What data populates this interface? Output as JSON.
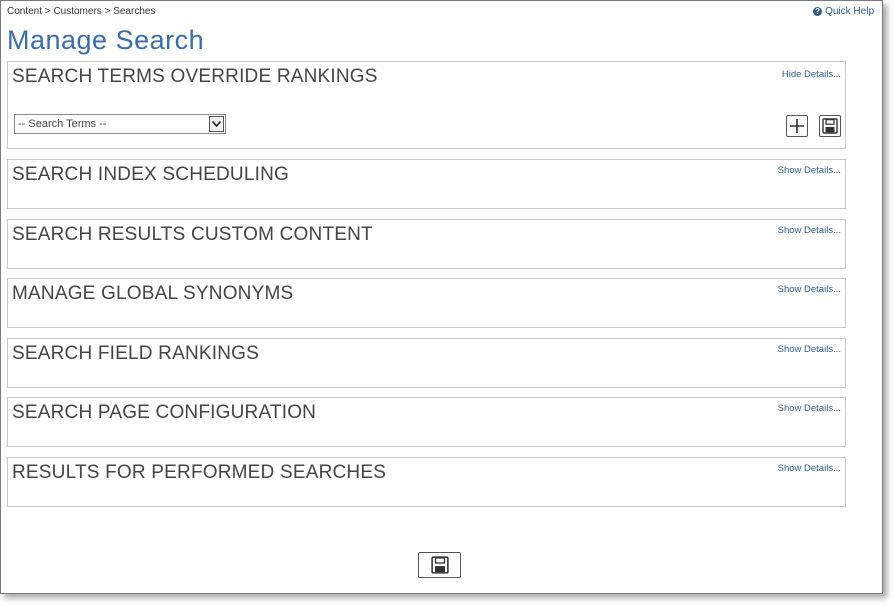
{
  "breadcrumb": {
    "items": [
      "Content",
      "Customers",
      "Searches"
    ],
    "separator": " > ",
    "text": "Content > Customers > Searches"
  },
  "quick_help": {
    "label": "Quick Help",
    "icon": "question-circle-icon"
  },
  "page": {
    "title": "Manage Search"
  },
  "sections": [
    {
      "title": "SEARCH TERMS OVERRIDE RANKINGS",
      "toggle": "Hide Details...",
      "expanded": true
    },
    {
      "title": "SEARCH INDEX SCHEDULING",
      "toggle": "Show Details...",
      "expanded": false
    },
    {
      "title": "SEARCH RESULTS CUSTOM CONTENT",
      "toggle": "Show Details...",
      "expanded": false
    },
    {
      "title": "MANAGE GLOBAL SYNONYMS",
      "toggle": "Show Details...",
      "expanded": false
    },
    {
      "title": "SEARCH FIELD RANKINGS",
      "toggle": "Show Details...",
      "expanded": false
    },
    {
      "title": "SEARCH PAGE CONFIGURATION",
      "toggle": "Show Details...",
      "expanded": false
    },
    {
      "title": "RESULTS FOR PERFORMED SEARCHES",
      "toggle": "Show Details...",
      "expanded": false
    }
  ],
  "search_terms": {
    "selected": "-- Search Terms --"
  },
  "icons": {
    "add": "plus-icon",
    "save": "floppy-disk-icon"
  },
  "colors": {
    "title": "#3a6ea5",
    "link": "#2e5c8a",
    "section_border": "#c8c8c8",
    "section_text": "#444444"
  }
}
